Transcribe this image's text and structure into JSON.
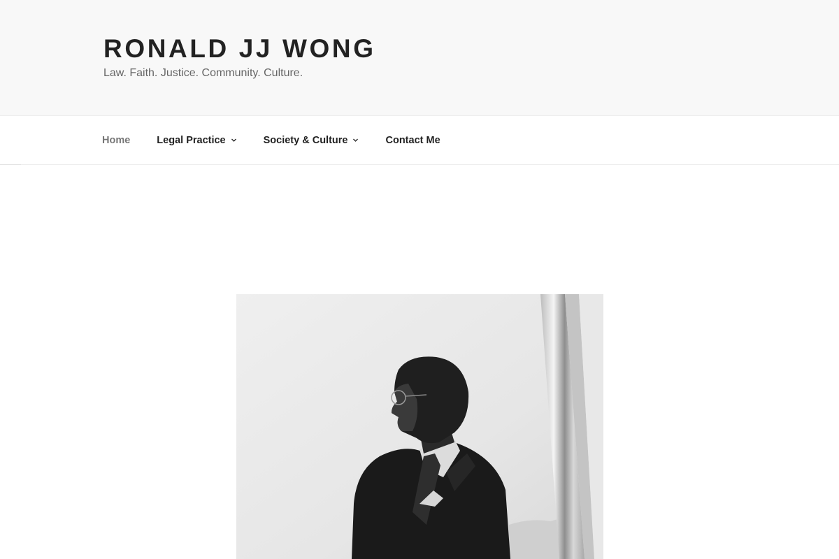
{
  "site": {
    "title": "RONALD JJ WONG",
    "tagline": "Law. Faith. Justice. Community. Culture."
  },
  "nav": {
    "items": [
      {
        "label": "Home",
        "current": true,
        "has_submenu": false
      },
      {
        "label": "Legal Practice",
        "current": false,
        "has_submenu": true
      },
      {
        "label": "Society & Culture",
        "current": false,
        "has_submenu": true
      },
      {
        "label": "Contact Me",
        "current": false,
        "has_submenu": false
      }
    ],
    "submenu_icon": "chevron-down-icon"
  },
  "featured_image": {
    "description": "",
    "style": "black-and-white"
  },
  "colors": {
    "header_background": "#f8f8f8",
    "title": "#222222",
    "tagline": "#666666",
    "nav_text": "#222222",
    "nav_current": "#767676"
  }
}
